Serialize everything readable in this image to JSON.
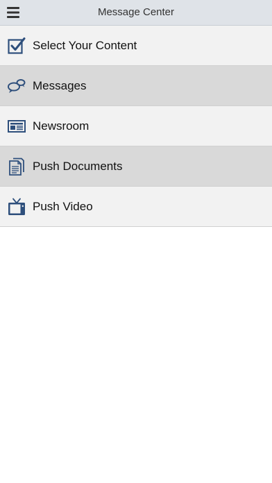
{
  "header": {
    "title": "Message Center",
    "menu_icon": "hamburger-menu-icon"
  },
  "menu": {
    "items": [
      {
        "label": "Select Your Content",
        "icon": "checkbox-check-icon"
      },
      {
        "label": "Messages",
        "icon": "chat-bubbles-icon"
      },
      {
        "label": "Newsroom",
        "icon": "newspaper-icon"
      },
      {
        "label": "Push Documents",
        "icon": "documents-icon"
      },
      {
        "label": "Push Video",
        "icon": "tv-icon"
      }
    ]
  },
  "colors": {
    "header_bg": "#dfe3e8",
    "row_light": "#f2f2f2",
    "row_dark": "#d9d9d9",
    "icon_blue": "#2e4f7c"
  }
}
